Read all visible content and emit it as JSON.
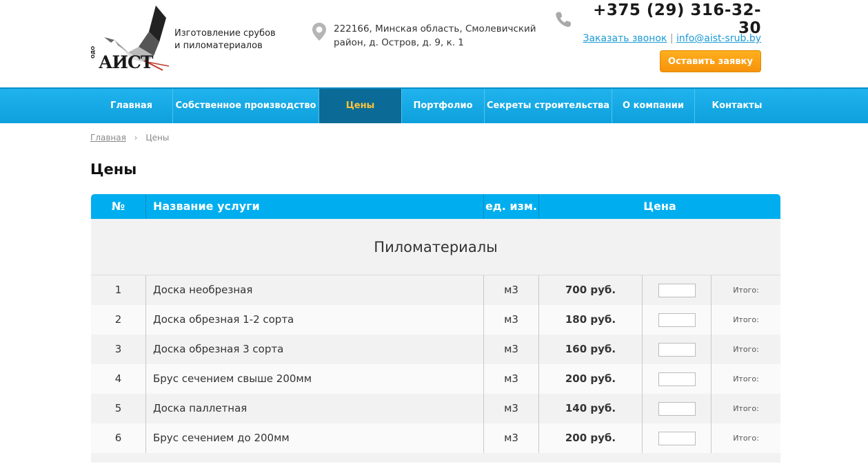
{
  "header": {
    "logo_text": "АИСТ",
    "logo_prefix": "ОДО",
    "tagline_line1": "Изготовление срубов",
    "tagline_line2": "и пиломатериалов",
    "address_line1": "222166, Минская область, Смолевичский",
    "address_line2": "район, д. Остров, д. 9, к. 1",
    "phone": "+375 (29) 316-32-30",
    "callback_link": "Заказать звонок",
    "separator": "|",
    "email": "info@aist-srub.by",
    "order_button": "Оставить заявку"
  },
  "nav": {
    "items": [
      {
        "label": "Главная"
      },
      {
        "label": "Собственное производство"
      },
      {
        "label": "Цены"
      },
      {
        "label": "Портфолио"
      },
      {
        "label": "Секреты строительства"
      },
      {
        "label": "О компании"
      },
      {
        "label": "Контакты"
      }
    ],
    "active_index": 2
  },
  "breadcrumb": {
    "home": "Главная",
    "current": "Цены"
  },
  "page_title": "Цены",
  "table": {
    "headers": {
      "num": "№",
      "name": "Название услуги",
      "unit": "ед. изм.",
      "price": "Цена"
    },
    "section_title": "Пиломатериалы",
    "rows": [
      {
        "num": "1",
        "name": "Доска необрезная",
        "unit": "м3",
        "price": "700 руб.",
        "total_label": "Итого:"
      },
      {
        "num": "2",
        "name": "Доска обрезная 1-2 сорта",
        "unit": "м3",
        "price": "180 руб.",
        "total_label": "Итого:"
      },
      {
        "num": "3",
        "name": "Доска обрезная 3 сорта",
        "unit": "м3",
        "price": "160 руб.",
        "total_label": "Итого:"
      },
      {
        "num": "4",
        "name": "Брус сечением свыше 200мм",
        "unit": "м3",
        "price": "200 руб.",
        "total_label": "Итого:"
      },
      {
        "num": "5",
        "name": "Доска паллетная",
        "unit": "м3",
        "price": "140 руб.",
        "total_label": "Итого:"
      },
      {
        "num": "6",
        "name": "Брус сечением до 200мм",
        "unit": "м3",
        "price": "200 руб.",
        "total_label": "Итого:"
      }
    ]
  },
  "colors": {
    "nav_blue": "#0ea0dc",
    "nav_active": "#0b6b96",
    "active_text": "#ffc53a",
    "order_orange": "#f7930a",
    "link_blue": "#1a9ad6"
  }
}
